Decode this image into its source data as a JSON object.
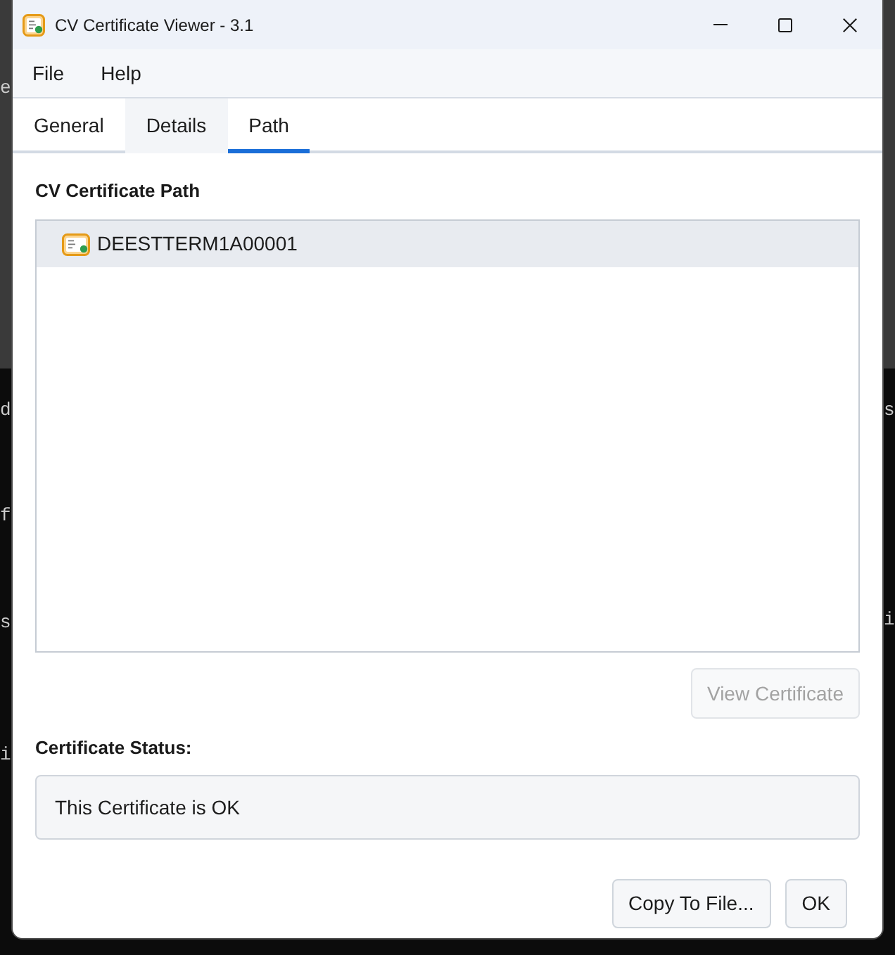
{
  "background_terminal": {
    "left_fragments": [
      "e",
      "d",
      "f",
      "s",
      "i"
    ],
    "right_fragments": [
      "s",
      "i"
    ]
  },
  "window": {
    "title": "CV Certificate Viewer - 3.1"
  },
  "menu": [
    "File",
    "Help"
  ],
  "tabs": [
    {
      "label": "General",
      "selected": false,
      "hovered": false
    },
    {
      "label": "Details",
      "selected": false,
      "hovered": true
    },
    {
      "label": "Path",
      "selected": true,
      "hovered": false
    }
  ],
  "path_panel": {
    "heading": "CV Certificate Path",
    "items": [
      {
        "label": "DEESTTERM1A00001",
        "selected": true
      }
    ],
    "view_button": {
      "label": "View Certificate",
      "disabled": true
    }
  },
  "status": {
    "heading": "Certificate Status:",
    "text": "This Certificate is OK"
  },
  "buttons": [
    "Copy To File...",
    "OK"
  ]
}
